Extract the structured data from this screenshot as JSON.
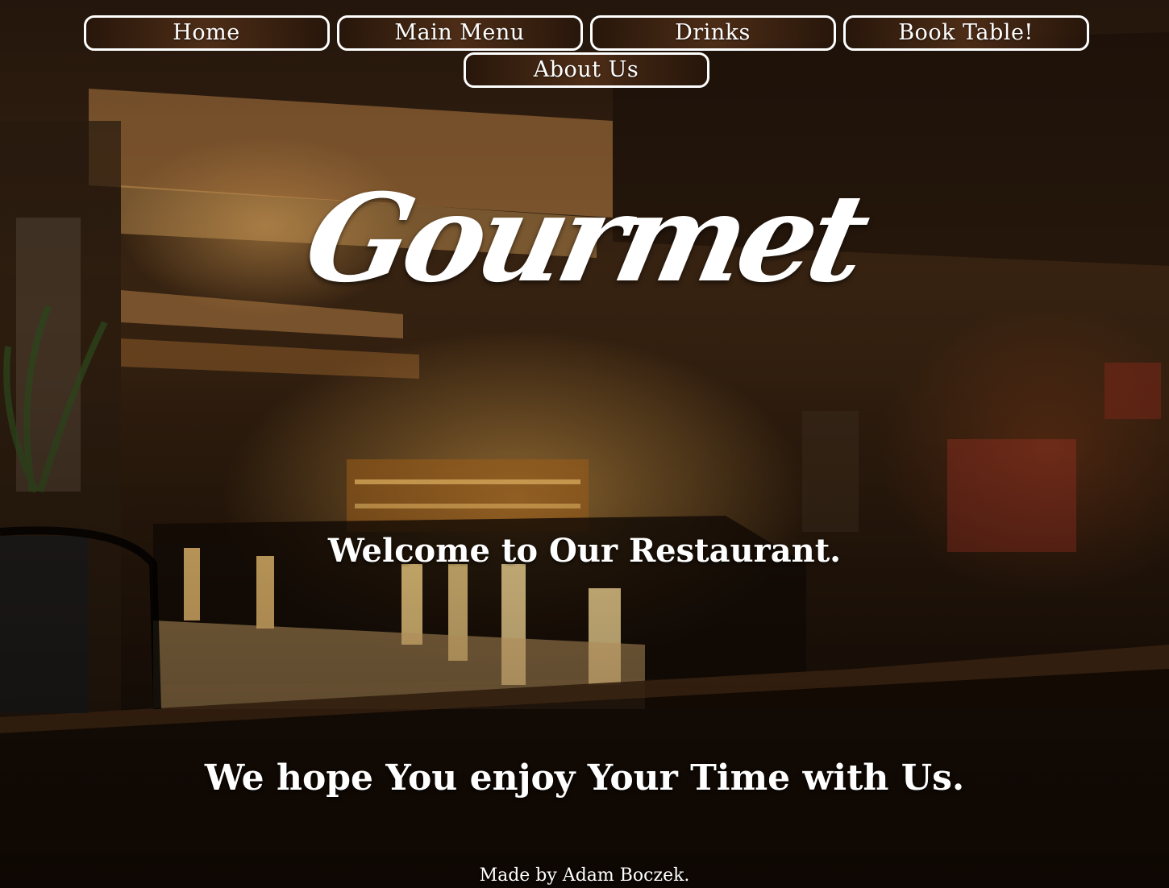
{
  "nav": {
    "items": [
      {
        "label": "Home"
      },
      {
        "label": "Main Menu"
      },
      {
        "label": "Drinks"
      },
      {
        "label": "Book Table!"
      },
      {
        "label": "About Us"
      }
    ]
  },
  "hero": {
    "logo_text": "Gourmet",
    "welcome_text": "Welcome to Our Restaurant.",
    "tagline": "We hope You enjoy Your Time with Us."
  },
  "footer": {
    "credit": "Made by Adam Boczek."
  },
  "colors": {
    "text": "#ffffff",
    "button_border": "#ffffff",
    "background_warm": "#3b2512"
  }
}
